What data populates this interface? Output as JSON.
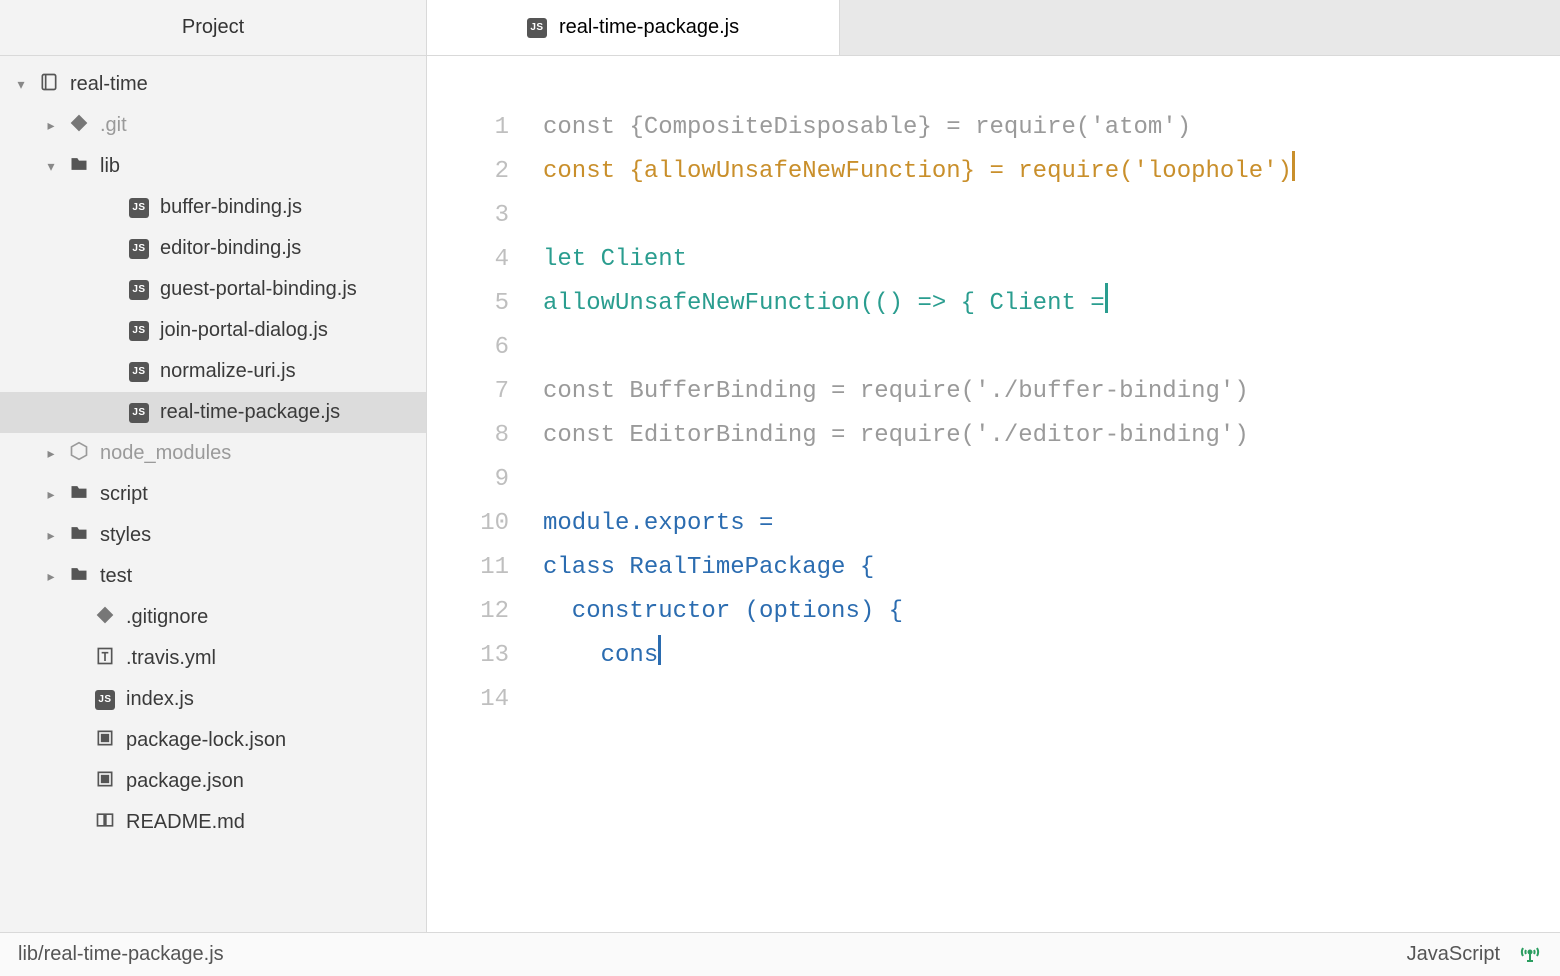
{
  "sidebar": {
    "title": "Project",
    "tree": [
      {
        "label": "real-time",
        "icon": "repo",
        "indent": 0,
        "chev": "down",
        "muted": false,
        "selected": false
      },
      {
        "label": ".git",
        "icon": "git",
        "indent": 1,
        "chev": "right",
        "muted": true,
        "selected": false
      },
      {
        "label": "lib",
        "icon": "folder",
        "indent": 1,
        "chev": "down",
        "muted": false,
        "selected": false
      },
      {
        "label": "buffer-binding.js",
        "icon": "js",
        "indent": 3,
        "chev": "",
        "muted": false,
        "selected": false
      },
      {
        "label": "editor-binding.js",
        "icon": "js",
        "indent": 3,
        "chev": "",
        "muted": false,
        "selected": false
      },
      {
        "label": "guest-portal-binding.js",
        "icon": "js",
        "indent": 3,
        "chev": "",
        "muted": false,
        "selected": false
      },
      {
        "label": "join-portal-dialog.js",
        "icon": "js",
        "indent": 3,
        "chev": "",
        "muted": false,
        "selected": false
      },
      {
        "label": "normalize-uri.js",
        "icon": "js",
        "indent": 3,
        "chev": "",
        "muted": false,
        "selected": false
      },
      {
        "label": "real-time-package.js",
        "icon": "js",
        "indent": 3,
        "chev": "",
        "muted": false,
        "selected": true
      },
      {
        "label": "node_modules",
        "icon": "node",
        "indent": 1,
        "chev": "right",
        "muted": true,
        "selected": false
      },
      {
        "label": "script",
        "icon": "folder",
        "indent": 1,
        "chev": "right",
        "muted": false,
        "selected": false
      },
      {
        "label": "styles",
        "icon": "folder",
        "indent": 1,
        "chev": "right",
        "muted": false,
        "selected": false
      },
      {
        "label": "test",
        "icon": "folder",
        "indent": 1,
        "chev": "right",
        "muted": false,
        "selected": false
      },
      {
        "label": ".gitignore",
        "icon": "git",
        "indent": 2,
        "chev": "",
        "muted": false,
        "selected": false
      },
      {
        "label": ".travis.yml",
        "icon": "text",
        "indent": 2,
        "chev": "",
        "muted": false,
        "selected": false
      },
      {
        "label": "index.js",
        "icon": "js",
        "indent": 2,
        "chev": "",
        "muted": false,
        "selected": false
      },
      {
        "label": "package-lock.json",
        "icon": "json",
        "indent": 2,
        "chev": "",
        "muted": false,
        "selected": false
      },
      {
        "label": "package.json",
        "icon": "json",
        "indent": 2,
        "chev": "",
        "muted": false,
        "selected": false
      },
      {
        "label": "README.md",
        "icon": "book",
        "indent": 2,
        "chev": "",
        "muted": false,
        "selected": false
      }
    ]
  },
  "tabs": {
    "active": {
      "label": "real-time-package.js",
      "icon": "js"
    }
  },
  "editor": {
    "lines": [
      {
        "n": 1,
        "segments": [
          {
            "t": "const {CompositeDisposable} = require('atom')",
            "c": "gray"
          }
        ],
        "cursor": ""
      },
      {
        "n": 2,
        "segments": [
          {
            "t": "const {allowUnsafeNewFunction} = require('loophole')",
            "c": "amber"
          }
        ],
        "cursor": "amber"
      },
      {
        "n": 3,
        "segments": [],
        "cursor": ""
      },
      {
        "n": 4,
        "segments": [
          {
            "t": "let Client",
            "c": "teal"
          }
        ],
        "cursor": ""
      },
      {
        "n": 5,
        "segments": [
          {
            "t": "allowUnsafeNewFunction(() => { Client =",
            "c": "teal"
          }
        ],
        "cursor": "teal"
      },
      {
        "n": 6,
        "segments": [],
        "cursor": ""
      },
      {
        "n": 7,
        "segments": [
          {
            "t": "const BufferBinding = require('./buffer-binding')",
            "c": "gray"
          }
        ],
        "cursor": ""
      },
      {
        "n": 8,
        "segments": [
          {
            "t": "const EditorBinding = require('./editor-binding')",
            "c": "gray"
          }
        ],
        "cursor": ""
      },
      {
        "n": 9,
        "segments": [],
        "cursor": ""
      },
      {
        "n": 10,
        "segments": [
          {
            "t": "module.exports =",
            "c": "blue"
          }
        ],
        "cursor": ""
      },
      {
        "n": 11,
        "segments": [
          {
            "t": "class RealTimePackage {",
            "c": "blue"
          }
        ],
        "cursor": ""
      },
      {
        "n": 12,
        "segments": [
          {
            "t": "  constructor (options) {",
            "c": "blue"
          }
        ],
        "cursor": ""
      },
      {
        "n": 13,
        "segments": [
          {
            "t": "    cons",
            "c": "blue"
          }
        ],
        "cursor": "blue"
      },
      {
        "n": 14,
        "segments": [],
        "cursor": ""
      }
    ]
  },
  "statusbar": {
    "path": "lib/real-time-package.js",
    "grammar": "JavaScript"
  }
}
